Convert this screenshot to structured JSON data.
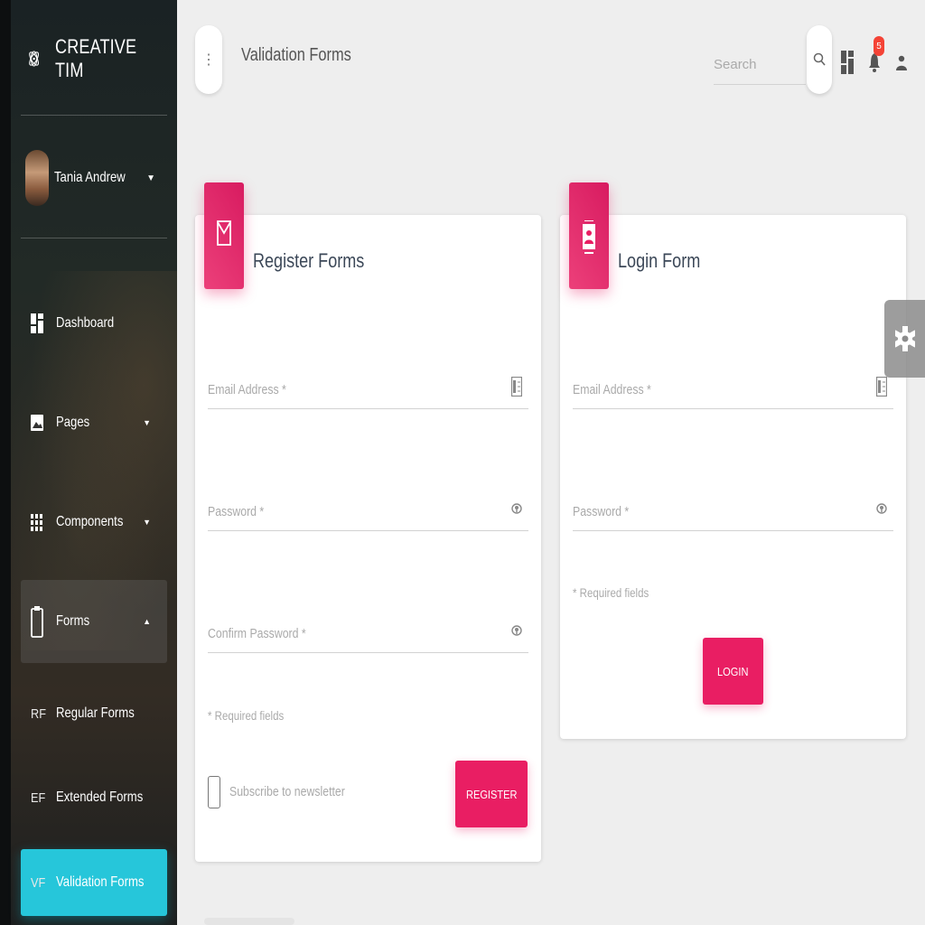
{
  "sidebar": {
    "brand": "CREATIVE TIM",
    "user": {
      "name": "Tania Andrew"
    },
    "items": [
      {
        "label": "Dashboard"
      },
      {
        "label": "Pages"
      },
      {
        "label": "Components"
      },
      {
        "label": "Forms"
      }
    ],
    "subitems": [
      {
        "abbr": "RF",
        "label": "Regular Forms"
      },
      {
        "abbr": "EF",
        "label": "Extended Forms"
      },
      {
        "abbr": "VF",
        "label": "Validation Forms"
      }
    ],
    "active_color": "#26c6da"
  },
  "header": {
    "title": "Validation Forms",
    "search_placeholder": "Search",
    "notification_count": "5"
  },
  "register_card": {
    "title": "Register Forms",
    "email_label": "Email Address *",
    "password_label": "Password *",
    "confirm_label": "Confirm Password *",
    "required_note": "* Required fields",
    "checkbox_label": "Subscribe to newsletter",
    "button": "REGISTER"
  },
  "login_card": {
    "title": "Login Form",
    "email_label": "Email Address *",
    "password_label": "Password *",
    "required_note": "* Required fields",
    "button": "LOGIN"
  },
  "colors": {
    "accent": "#e91e63",
    "background": "#eeeeee"
  }
}
